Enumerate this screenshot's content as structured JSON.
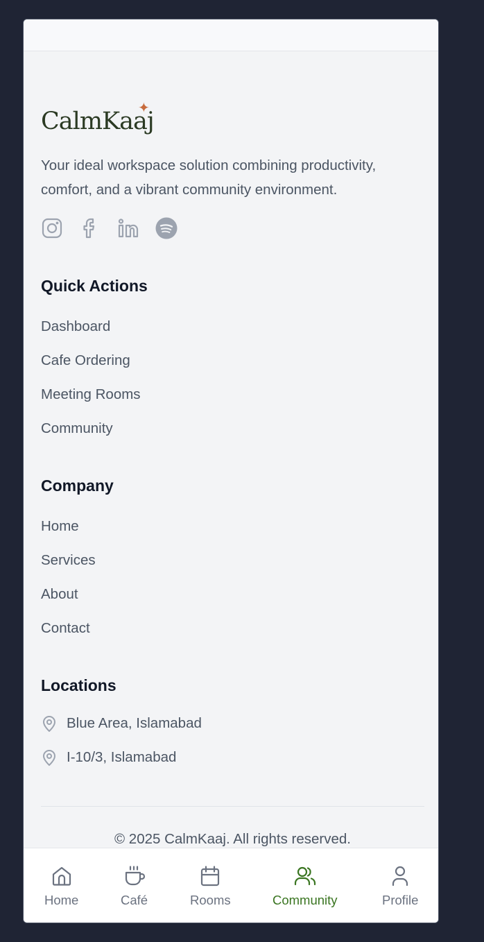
{
  "brand": {
    "name": "CalmKaaj",
    "spark_glyph": "✦",
    "tagline": "Your ideal workspace solution combining productivity, comfort, and a vibrant community environment."
  },
  "social_icons": [
    "instagram-icon",
    "facebook-icon",
    "linkedin-icon",
    "spotify-icon"
  ],
  "quick_actions": {
    "title": "Quick Actions",
    "links": [
      "Dashboard",
      "Cafe Ordering",
      "Meeting Rooms",
      "Community"
    ]
  },
  "company": {
    "title": "Company",
    "links": [
      "Home",
      "Services",
      "About",
      "Contact"
    ]
  },
  "locations": {
    "title": "Locations",
    "items": [
      "Blue Area, Islamabad",
      "I-10/3, Islamabad"
    ]
  },
  "copyright": "© 2025 CalmKaaj. All rights reserved.",
  "bottom_nav": {
    "items": [
      {
        "label": "Home",
        "icon": "home-icon"
      },
      {
        "label": "Café",
        "icon": "coffee-cup-icon"
      },
      {
        "label": "Rooms",
        "icon": "calendar-icon"
      },
      {
        "label": "Community",
        "icon": "users-icon"
      },
      {
        "label": "Profile",
        "icon": "user-icon"
      }
    ],
    "active": "Community"
  },
  "colors": {
    "page_background": "#1f2434",
    "surface": "#f3f4f6",
    "brand_text": "#2b3a23",
    "brand_accent": "#c76b3d",
    "active_nav": "#3a7521",
    "muted_icon": "#9ca3af"
  }
}
